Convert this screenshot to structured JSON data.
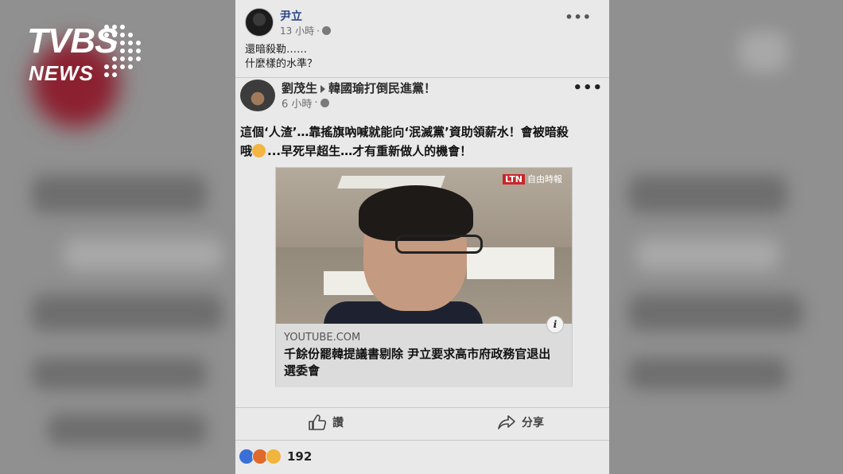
{
  "logo": {
    "brand": "TVBS",
    "sub": "NEWS"
  },
  "post": {
    "author": "尹立",
    "time": "13 小時",
    "more_icon": "more-dots-icon",
    "status_lines": [
      "還暗殺勒……",
      "什麼樣的水準？"
    ]
  },
  "shared": {
    "author": "劉茂生",
    "target_group": "韓國瑜打倒民進黨！",
    "time": "6 小時",
    "text_line1": "這個‘人渣’…靠搖旗吶喊就能向‘泯滅黨’資助領薪水！會被暗殺",
    "text_line2_prefix": "哦",
    "text_line2_rest": "...早死早超生…才有重新做人的機會！",
    "emoji_icon": "astonished-emoji-icon"
  },
  "link_card": {
    "watermark_badge": "LTN",
    "watermark_text": "自由時報",
    "domain": "YOUTUBE.COM",
    "headline": "千餘份罷韓提議書剔除 尹立要求高市府政務官退出選委會",
    "info_icon": "i"
  },
  "actions": {
    "like_label": "讚",
    "share_label": "分享"
  },
  "reactions": {
    "count": "192"
  },
  "colors": {
    "author_link": "#2b4a8a",
    "like_blue": "#3a6fd8",
    "angry_orange": "#e06a2c",
    "haha_yellow": "#f1b43c",
    "ltn_red": "#c8262b"
  }
}
